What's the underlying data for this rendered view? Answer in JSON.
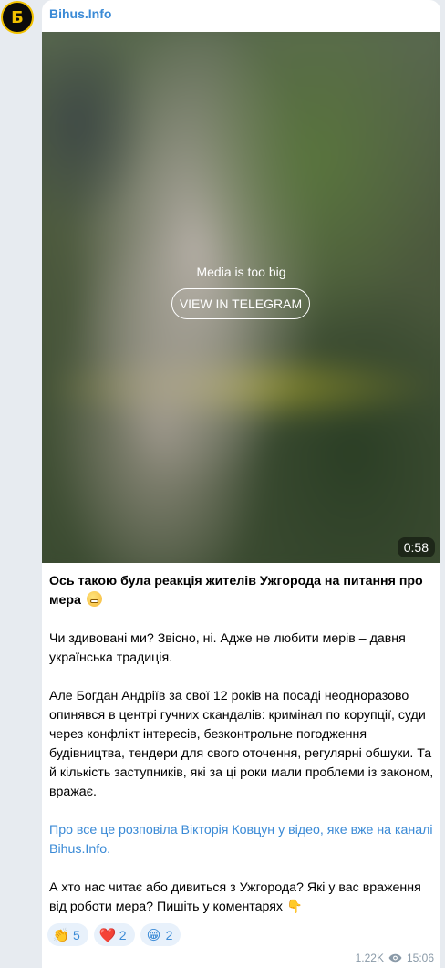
{
  "channel": {
    "name": "Bihus.Info",
    "avatar_letter": "Б"
  },
  "media": {
    "message": "Media is too big",
    "button_label": "VIEW IN TELEGRAM",
    "duration": "0:58"
  },
  "post": {
    "headline": "Ось такою була реакція жителів Ужгорода на питання про мера",
    "headline_emoji": "grimacing-face",
    "p1": "Чи здивовані ми? Звісно, ні. Адже не любити мерів – давня українська традиція.",
    "p2": "Але Богдан Андріїв за свої 12 років на посаді неодноразово опинявся в центрі гучних скандалів: кримінал по корупції, суди через конфлікт інтересів, безконтрольне погодження будівництва, тендери для свого оточення, регулярні обшуки. Та й кількість заступників, які за ці роки мали проблеми із законом, вражає.",
    "link_text": "Про все це розповіла Вікторія Ковцун у відео, яке вже на каналі Bihus.Info.",
    "p4": "А хто нас читає або дивиться з Ужгорода? Які у вас враження від роботи мера? Пишіть у коментарях",
    "p4_emoji": "👇"
  },
  "reactions": [
    {
      "icon": "clapping-hands",
      "glyph": "👏",
      "count": "5"
    },
    {
      "icon": "red-heart",
      "glyph": "❤️",
      "count": "2"
    },
    {
      "icon": "grinning-face",
      "glyph": "😁",
      "count": "2"
    }
  ],
  "meta": {
    "views": "1.22K",
    "time": "15:06"
  },
  "colors": {
    "link": "#3a8ad6",
    "background": "#e7ebf0",
    "reaction_bg": "#e8f1fb"
  }
}
